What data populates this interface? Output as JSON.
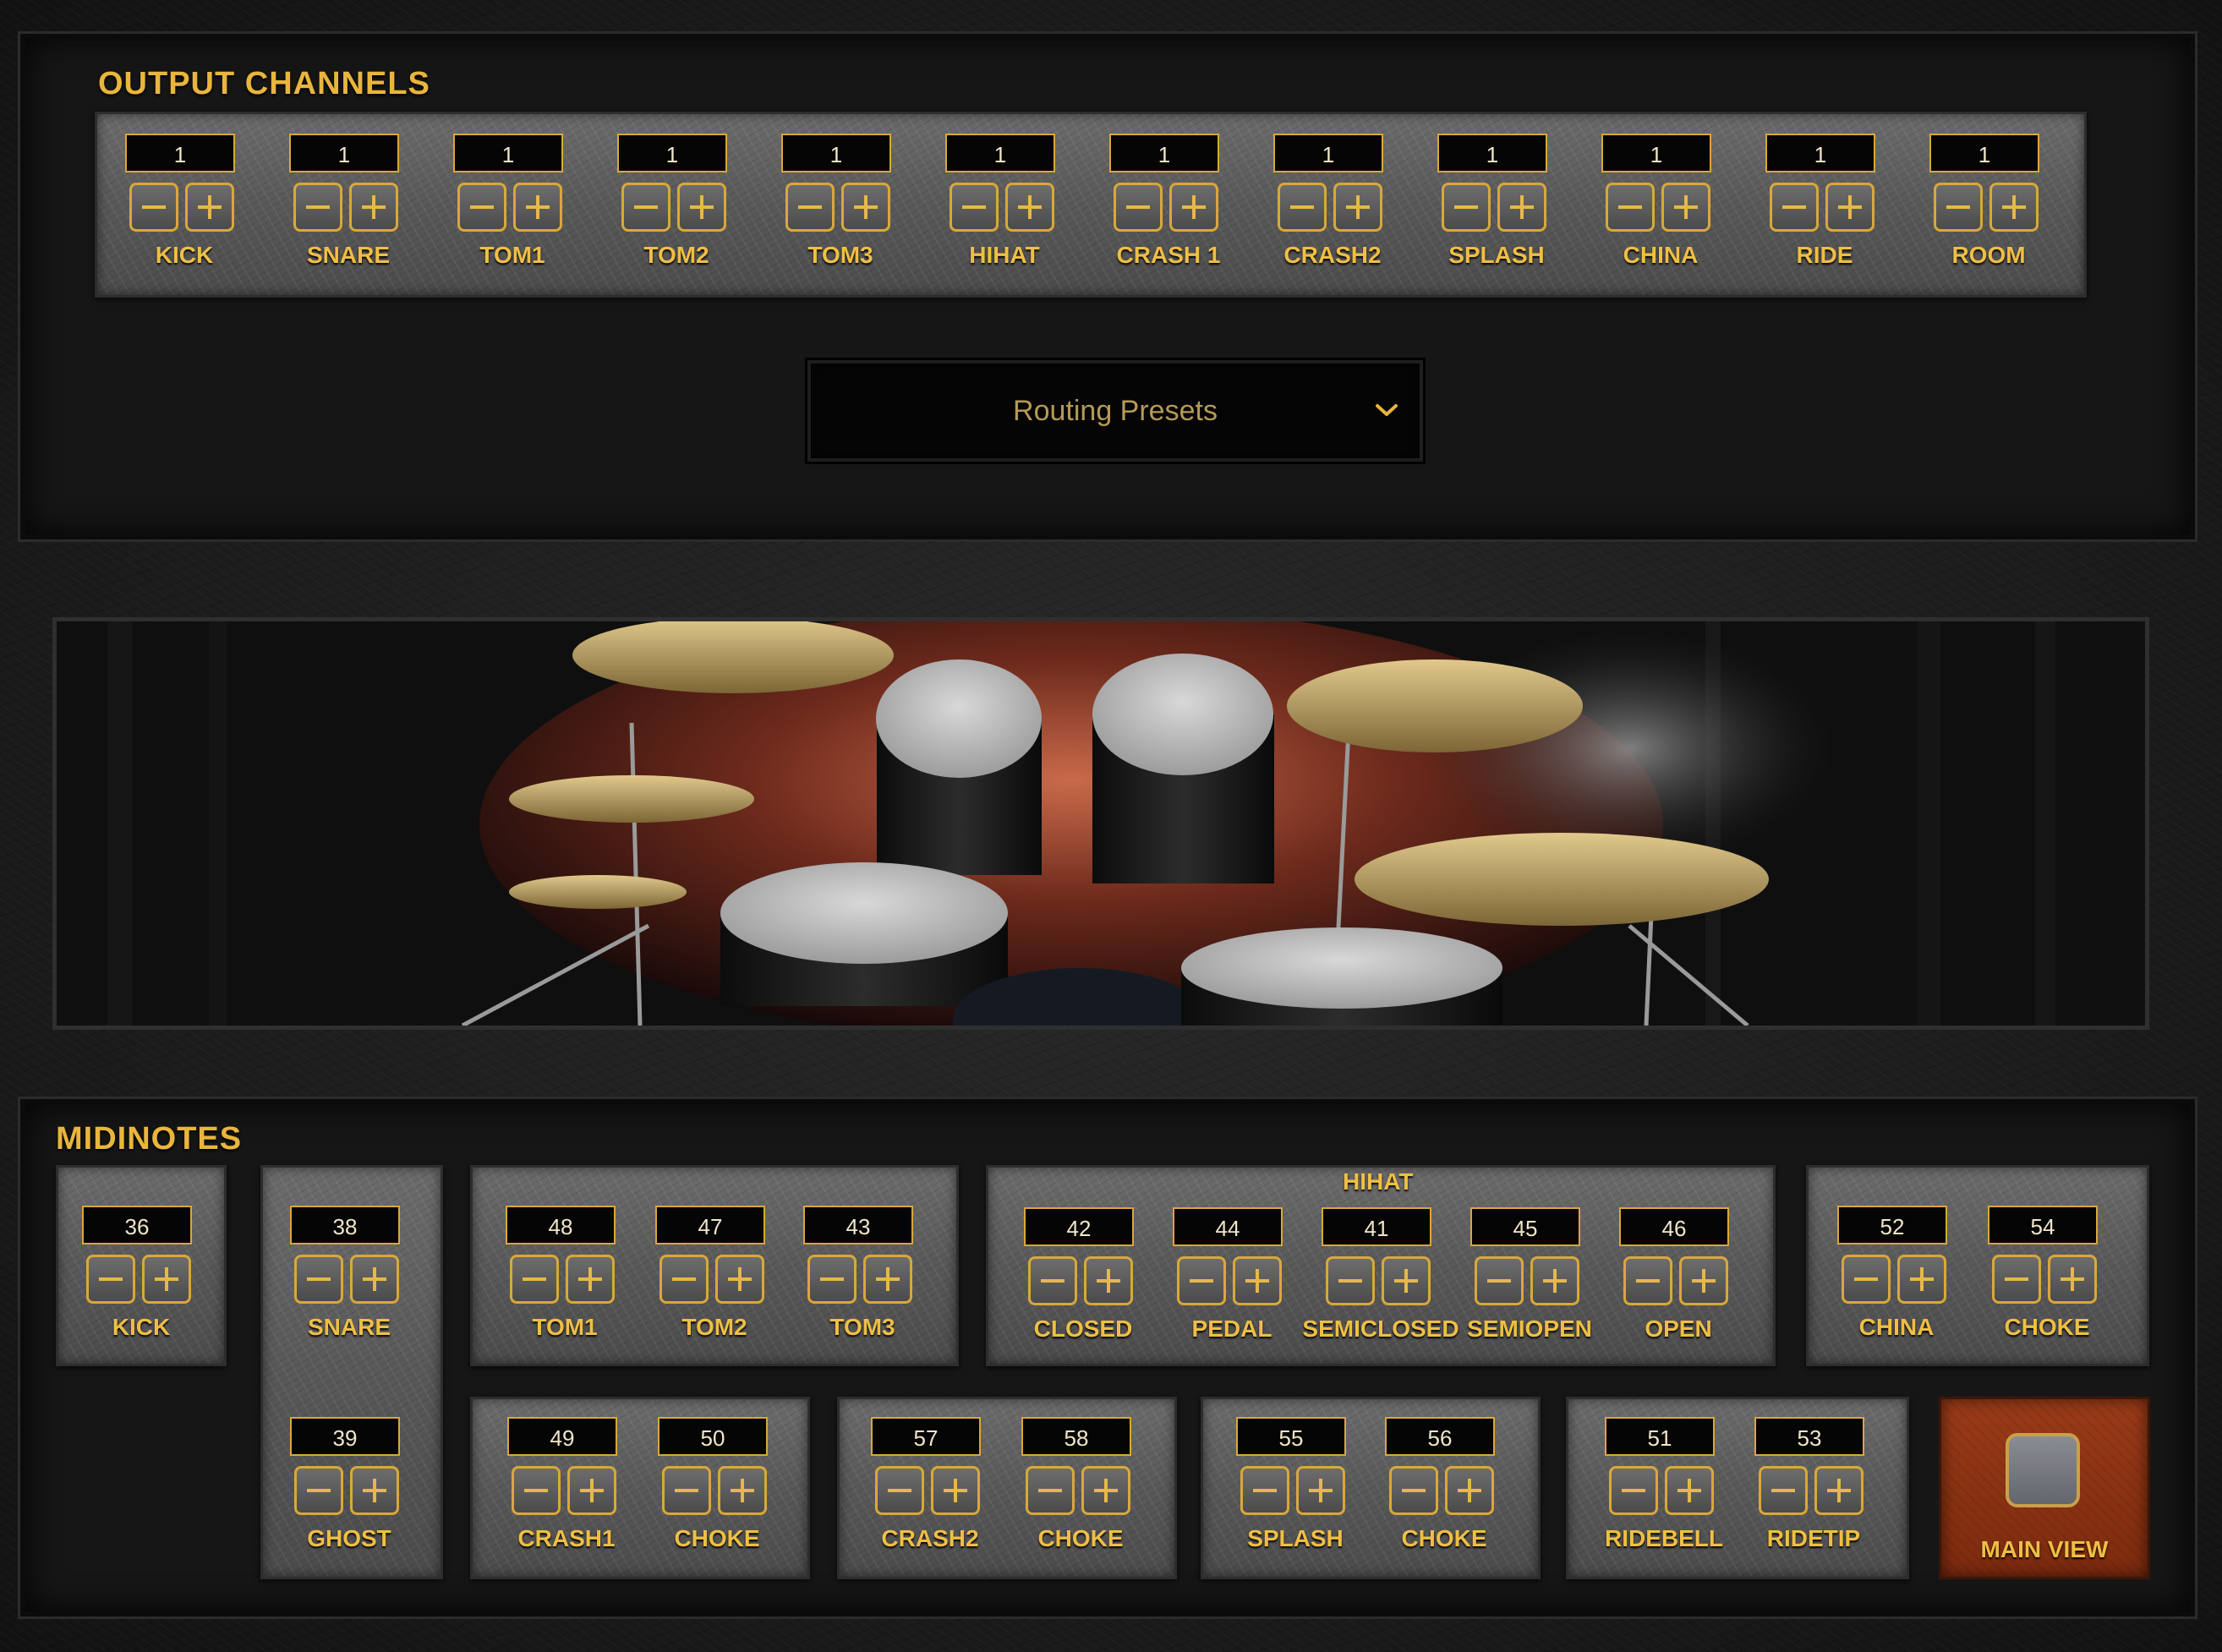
{
  "output": {
    "title": "OUTPUT CHANNELS",
    "channels": [
      {
        "label": "KICK",
        "value": "1"
      },
      {
        "label": "SNARE",
        "value": "1"
      },
      {
        "label": "TOM1",
        "value": "1"
      },
      {
        "label": "TOM2",
        "value": "1"
      },
      {
        "label": "TOM3",
        "value": "1"
      },
      {
        "label": "HIHAT",
        "value": "1"
      },
      {
        "label": "CRASH 1",
        "value": "1"
      },
      {
        "label": "CRASH2",
        "value": "1"
      },
      {
        "label": "SPLASH",
        "value": "1"
      },
      {
        "label": "CHINA",
        "value": "1"
      },
      {
        "label": "RIDE",
        "value": "1"
      },
      {
        "label": "ROOM",
        "value": "1"
      }
    ]
  },
  "routing": {
    "label": "Routing Presets"
  },
  "midi": {
    "title": "MIDINOTES",
    "kick": {
      "label": "KICK",
      "value": "36"
    },
    "snare": {
      "label": "SNARE",
      "value": "38"
    },
    "ghost": {
      "label": "GHOST",
      "value": "39"
    },
    "toms": [
      {
        "label": "TOM1",
        "value": "48"
      },
      {
        "label": "TOM2",
        "value": "47"
      },
      {
        "label": "TOM3",
        "value": "43"
      }
    ],
    "hihat": {
      "title": "HIHAT",
      "items": [
        {
          "label": "CLOSED",
          "value": "42"
        },
        {
          "label": "PEDAL",
          "value": "44"
        },
        {
          "label": "SEMICLOSED",
          "value": "41"
        },
        {
          "label": "SEMIOPEN",
          "value": "45"
        },
        {
          "label": "OPEN",
          "value": "46"
        }
      ]
    },
    "china": [
      {
        "label": "CHINA",
        "value": "52"
      },
      {
        "label": "CHOKE",
        "value": "54"
      }
    ],
    "crash1": [
      {
        "label": "CRASH1",
        "value": "49"
      },
      {
        "label": "CHOKE",
        "value": "50"
      }
    ],
    "crash2": [
      {
        "label": "CRASH2",
        "value": "57"
      },
      {
        "label": "CHOKE",
        "value": "58"
      }
    ],
    "splash": [
      {
        "label": "SPLASH",
        "value": "55"
      },
      {
        "label": "CHOKE",
        "value": "56"
      }
    ],
    "ride": [
      {
        "label": "RIDEBELL",
        "value": "51"
      },
      {
        "label": "RIDETIP",
        "value": "53"
      }
    ]
  },
  "main_view": {
    "label": "MAIN VIEW"
  },
  "icons": {
    "minus": "minus-icon",
    "plus": "plus-icon",
    "dropdown": "chevron-down-icon"
  },
  "colors": {
    "accent": "#e9b53c",
    "panel": "#5a5a5a",
    "main_view": "#8a3212",
    "display_bg": "#050505"
  }
}
